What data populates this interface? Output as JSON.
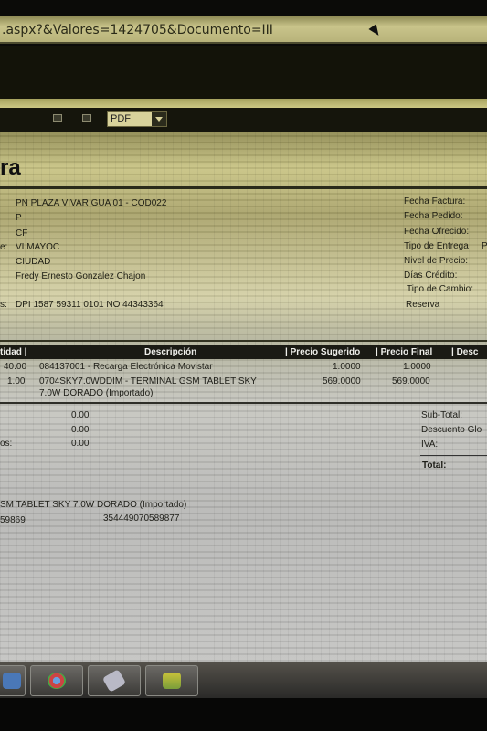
{
  "browser": {
    "url": ".aspx?&Valores=1424705&Documento=III"
  },
  "toolbar": {
    "format_selected": "PDF"
  },
  "document": {
    "title": "ra",
    "customer": {
      "name": "PN PLAZA VIVAR GUA 01 - COD022",
      "code": "P",
      "nit": "CF",
      "address_label": "e:",
      "address": "VI.MAYOC",
      "city": "CIUDAD",
      "seller": "Fredy Ernesto Gonzalez Chajon",
      "id_label": "s:",
      "id_doc": "DPI 1587 59311 0101  NO  44343364"
    },
    "right_labels": [
      "Fecha Factura:",
      "Fecha Pedido:",
      "Fecha Ofrecido:",
      "Tipo de Entrega",
      "Nivel de Precio:",
      "Días Crédito:",
      "Tipo de Cambio:",
      "Reserva"
    ],
    "right_extra": "P",
    "table": {
      "headers": {
        "cantidad": "tidad |",
        "descripcion": "Descripción",
        "precio_sugerido": "| Precio Sugerido",
        "precio_final": "| Precio Final",
        "desc": "| Desc"
      },
      "rows": [
        {
          "cantidad": "40.00",
          "descripcion": "084137001 - Recarga Electrónica  Movistar",
          "precio_sugerido": "1.0000",
          "precio_final": "1.0000"
        },
        {
          "cantidad": "1.00",
          "descripcion": "0704SKY7.0WDDIM - TERMINAL GSM TABLET SKY",
          "descripcion_2": "7.0W DORADO (Importado)",
          "precio_sugerido": "569.0000",
          "precio_final": "569.0000"
        }
      ]
    },
    "subtotals_left": {
      "v1": "0.00",
      "v2": "0.00",
      "label3": "os:",
      "v3": "0.00"
    },
    "totals_right": {
      "subtotal": "Sub-Total:",
      "descuento": "Descuento Glo",
      "iva": "IVA:",
      "total": "Total:"
    },
    "serial": {
      "item": "SM TABLET  SKY  7.0W DORADO (Importado)",
      "code": "59869",
      "imei": "354449070589877"
    }
  },
  "taskbar": {
    "buttons": [
      "ie-icon",
      "chrome-icon",
      "tool-icon",
      "folder-icon"
    ]
  }
}
